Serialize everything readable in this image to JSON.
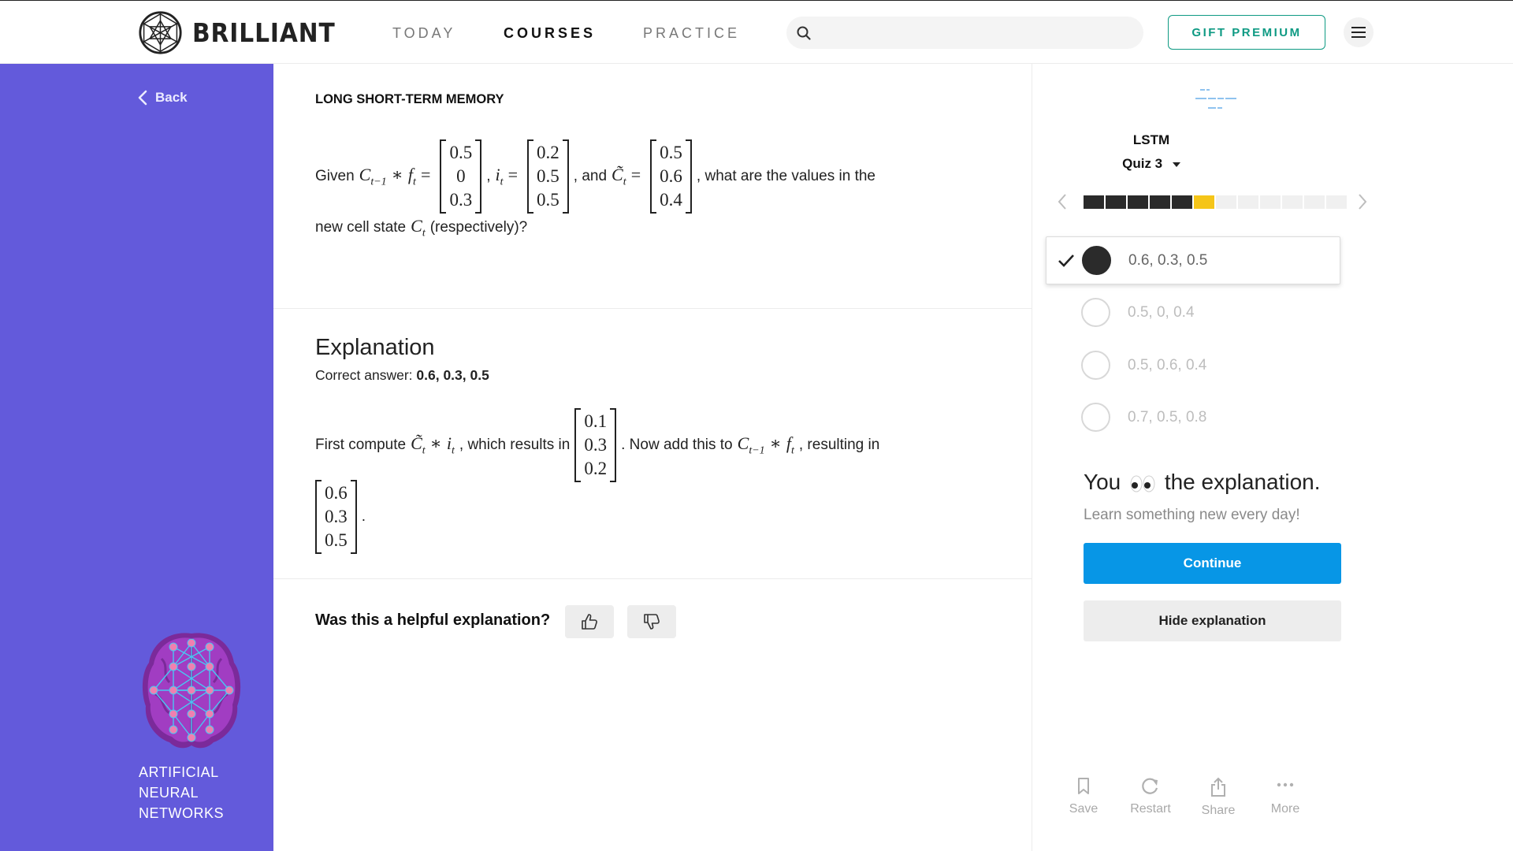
{
  "header": {
    "logo_text": "BRILLIANT",
    "nav": [
      "TODAY",
      "COURSES",
      "PRACTICE"
    ],
    "active_nav": "COURSES",
    "search": {
      "placeholder": "",
      "value": ""
    },
    "gift_label": "GIFT PREMIUM"
  },
  "sidebar": {
    "back_label": "Back",
    "course_name": "ARTIFICIAL NEURAL NETWORKS",
    "background": "#635adb"
  },
  "problem": {
    "eyebrow": "LONG SHORT-TERM MEMORY",
    "given": "Given",
    "comma": ",",
    "and": ", and",
    "question_tail": ", what are the values in the",
    "line2_pre": "new cell state",
    "line2_post": "(respectively)?",
    "matrices": {
      "cf": [
        "0.5",
        "0",
        "0.3"
      ],
      "i": [
        "0.2",
        "0.5",
        "0.5"
      ],
      "c_tilde": [
        "0.5",
        "0.6",
        "0.4"
      ]
    }
  },
  "explanation": {
    "title": "Explanation",
    "correct_prefix": "Correct answer:",
    "correct_value": "0.6, 0.3, 0.5",
    "first": "First compute",
    "which": ", which results in",
    "now": ". Now add this to",
    "resulting": ", resulting in",
    "period": ".",
    "matrices": {
      "product": [
        "0.1",
        "0.3",
        "0.2"
      ],
      "result": [
        "0.6",
        "0.3",
        "0.5"
      ]
    }
  },
  "feedback": {
    "question": "Was this a helpful explanation?"
  },
  "quiz": {
    "title": "LSTM",
    "quiz_label": "Quiz 3",
    "progress": {
      "total": 12,
      "completed": 5,
      "current": 6
    },
    "options": [
      {
        "label": "0.6, 0.3, 0.5",
        "selected": true
      },
      {
        "label": "0.5, 0, 0.4",
        "selected": false
      },
      {
        "label": "0.5, 0.6, 0.4",
        "selected": false
      },
      {
        "label": "0.7, 0.5, 0.8",
        "selected": false
      }
    ],
    "saw_pre": "You",
    "saw_post": "the explanation.",
    "learn": "Learn something new every day!",
    "continue_label": "Continue",
    "hide_label": "Hide explanation"
  },
  "toolbar": {
    "save": "Save",
    "restart": "Restart",
    "share": "Share",
    "more": "More"
  },
  "colors": {
    "accent_blue": "#0796e6",
    "accent_teal": "#0e9a83",
    "progress_current": "#f5c518",
    "sidebar_purple": "#635adb"
  }
}
